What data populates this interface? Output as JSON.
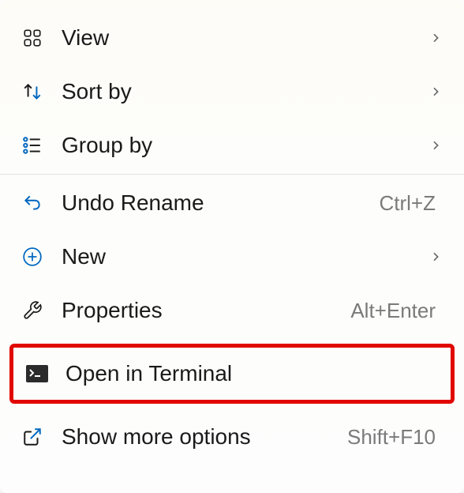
{
  "menu": {
    "view": {
      "label": "View",
      "has_submenu": true
    },
    "sort_by": {
      "label": "Sort by",
      "has_submenu": true
    },
    "group_by": {
      "label": "Group by",
      "has_submenu": true
    },
    "undo": {
      "label": "Undo Rename",
      "shortcut": "Ctrl+Z"
    },
    "new": {
      "label": "New",
      "has_submenu": true
    },
    "properties": {
      "label": "Properties",
      "shortcut": "Alt+Enter"
    },
    "terminal": {
      "label": "Open in Terminal"
    },
    "more": {
      "label": "Show more options",
      "shortcut": "Shift+F10"
    }
  },
  "colors": {
    "accent": "#0067c0",
    "text": "#1a1a1a",
    "muted": "#7a7a7a",
    "highlight": "#e10600"
  }
}
